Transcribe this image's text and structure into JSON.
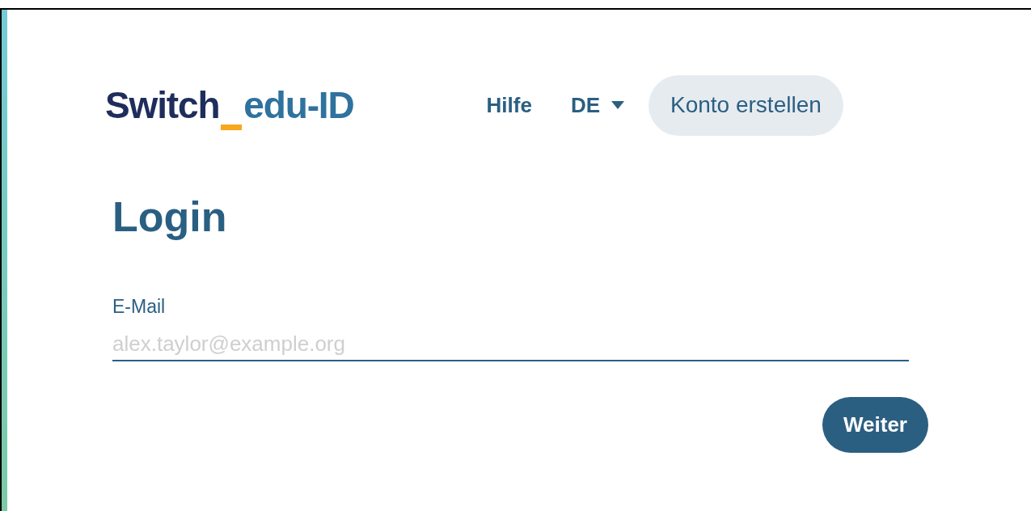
{
  "logo": {
    "primary": "Switch",
    "secondary": "edu-ID"
  },
  "nav": {
    "help": "Hilfe",
    "language": "DE",
    "create_account": "Konto erstellen"
  },
  "login": {
    "title": "Login",
    "email_label": "E-Mail",
    "email_placeholder": "alex.taylor@example.org",
    "submit": "Weiter"
  }
}
